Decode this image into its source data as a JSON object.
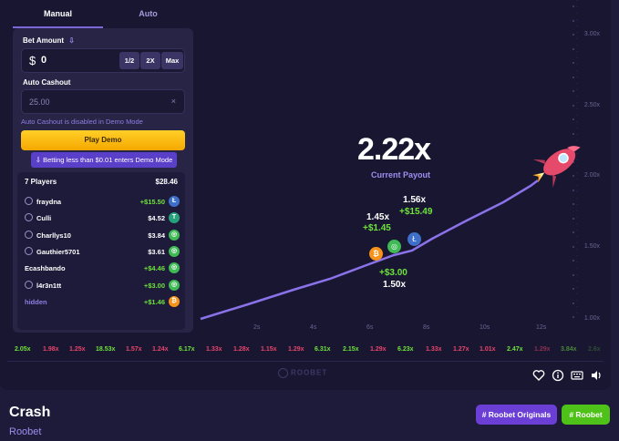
{
  "tabs": [
    {
      "label": "Manual"
    },
    {
      "label": "Auto"
    }
  ],
  "bet": {
    "amount_label": "Bet Amount",
    "currency": "$",
    "amount": "0",
    "half": "1/2",
    "double": "2X",
    "max": "Max"
  },
  "auto_cashout": {
    "label": "Auto Cashout",
    "value": "25.00",
    "clear": "×",
    "note": "Auto Cashout is disabled in Demo Mode"
  },
  "play_button": "Play Demo",
  "demo_notice": "Betting less than $0.01 enters Demo Mode",
  "players": {
    "count_label": "7 Players",
    "total": "$28.46",
    "rows": [
      {
        "name": "fraydna",
        "amount": "+$15.50",
        "coin": "litecoin",
        "coin_glyph": "Ł",
        "color": "#3f70c9",
        "won": true
      },
      {
        "name": "Culli",
        "amount": "$4.52",
        "coin": "tether",
        "coin_glyph": "T",
        "color": "#26a17b",
        "won": false
      },
      {
        "name": "Charllys10",
        "amount": "$3.84",
        "coin": "cash",
        "coin_glyph": "◎",
        "color": "#3fba55",
        "won": false
      },
      {
        "name": "Gauthier5701",
        "amount": "$3.61",
        "coin": "cash",
        "coin_glyph": "◎",
        "color": "#3fba55",
        "won": false
      },
      {
        "name": "Ecashbando",
        "amount": "+$4.46",
        "coin": "cash",
        "coin_glyph": "◎",
        "color": "#3fba55",
        "won": true
      },
      {
        "name": "l4r3n1tt",
        "amount": "+$3.00",
        "coin": "cash",
        "coin_glyph": "◎",
        "color": "#3fba55",
        "won": true
      },
      {
        "name": "hidden",
        "amount": "+$1.46",
        "coin": "bitcoin",
        "coin_glyph": "₿",
        "color": "#f7931a",
        "won": true,
        "hidden": true
      }
    ]
  },
  "graph": {
    "y_ticks": [
      "3.00x",
      "2.50x",
      "2.00x",
      "1.50x",
      "1.00x"
    ],
    "x_ticks": [
      "2s",
      "4s",
      "6s",
      "8s",
      "10s",
      "12s"
    ],
    "payout": "2.22x",
    "payout_label": "Current Payout",
    "cashouts": [
      {
        "mult": "1.45x",
        "amount": "+$1.45"
      },
      {
        "mult": "1.56x",
        "amount": "+$15.49"
      },
      {
        "mult": "1.50x",
        "amount": "+$3.00"
      }
    ]
  },
  "history": [
    {
      "v": "2.05x",
      "c": "green"
    },
    {
      "v": "1.98x",
      "c": "red"
    },
    {
      "v": "1.25x",
      "c": "red"
    },
    {
      "v": "18.53x",
      "c": "green"
    },
    {
      "v": "1.57x",
      "c": "red"
    },
    {
      "v": "1.24x",
      "c": "red"
    },
    {
      "v": "6.17x",
      "c": "green"
    },
    {
      "v": "1.33x",
      "c": "red"
    },
    {
      "v": "1.28x",
      "c": "red"
    },
    {
      "v": "1.15x",
      "c": "red"
    },
    {
      "v": "1.29x",
      "c": "red"
    },
    {
      "v": "6.31x",
      "c": "green"
    },
    {
      "v": "2.15x",
      "c": "green"
    },
    {
      "v": "1.29x",
      "c": "red"
    },
    {
      "v": "6.23x",
      "c": "green"
    },
    {
      "v": "1.33x",
      "c": "red"
    },
    {
      "v": "1.27x",
      "c": "red"
    },
    {
      "v": "1.01x",
      "c": "red"
    },
    {
      "v": "2.47x",
      "c": "green"
    },
    {
      "v": "1.29x",
      "c": "red"
    },
    {
      "v": "3.84x",
      "c": "green"
    },
    {
      "v": "2.6x",
      "c": "green"
    }
  ],
  "brand_logo": "ROOBET",
  "controls": [
    "heart-icon",
    "info-icon",
    "keyboard-icon",
    "volume-icon"
  ],
  "footer": {
    "title": "Crash",
    "subtitle": "Roobet",
    "tags": [
      {
        "label": "# Roobet Originals",
        "color": "#6b3fd6"
      },
      {
        "label": "# Roobet",
        "color": "#4fc21a"
      }
    ]
  }
}
